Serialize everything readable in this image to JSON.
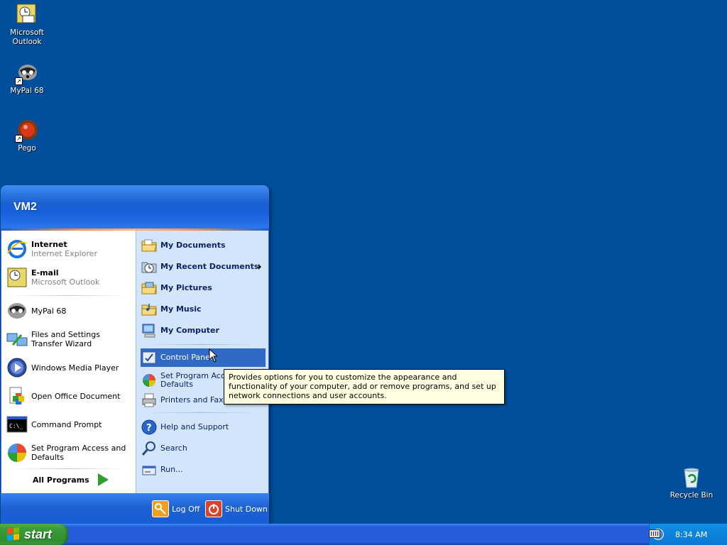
{
  "desktop": {
    "icons": [
      {
        "label": "Microsoft\nOutlook",
        "icon": "outlook-icon"
      },
      {
        "label": "MyPal 68",
        "icon": "mypal-icon"
      },
      {
        "label": "Pego",
        "icon": "pego-icon"
      },
      {
        "label": "Recycle Bin",
        "icon": "recycle-bin-icon"
      }
    ]
  },
  "start_menu": {
    "user": "VM2",
    "pinned": [
      {
        "title": "Internet",
        "subtitle": "Internet Explorer",
        "icon": "internet-explorer-icon"
      },
      {
        "title": "E-mail",
        "subtitle": "Microsoft Outlook",
        "icon": "outlook-icon"
      }
    ],
    "recent": [
      {
        "label": "MyPal 68",
        "icon": "mypal-icon"
      },
      {
        "label": "Files and Settings Transfer Wizard",
        "icon": "transfer-wizard-icon"
      },
      {
        "label": "Windows Media Player",
        "icon": "media-player-icon"
      },
      {
        "label": "Open Office Document",
        "icon": "office-document-icon"
      },
      {
        "label": "Command Prompt",
        "icon": "command-prompt-icon"
      },
      {
        "label": "Set Program Access and Defaults",
        "icon": "program-access-icon"
      }
    ],
    "all_programs": "All Programs",
    "places": [
      {
        "label": "My Documents",
        "icon": "folder-icon"
      },
      {
        "label": "My Recent Documents",
        "icon": "recent-documents-icon"
      },
      {
        "label": "My Pictures",
        "icon": "pictures-folder-icon"
      },
      {
        "label": "My Music",
        "icon": "music-folder-icon"
      },
      {
        "label": "My Computer",
        "icon": "computer-icon"
      }
    ],
    "system": [
      {
        "label": "Control Panel",
        "icon": "control-panel-icon"
      },
      {
        "label": "Set Program Access and Defaults",
        "icon": "program-access-icon"
      },
      {
        "label": "Printers and Faxes",
        "icon": "printer-icon"
      }
    ],
    "help": [
      {
        "label": "Help and Support",
        "icon": "help-icon"
      },
      {
        "label": "Search",
        "icon": "search-icon"
      },
      {
        "label": "Run...",
        "icon": "run-icon"
      }
    ],
    "log_off": "Log Off",
    "shut_down": "Shut Down"
  },
  "tooltip": "Provides options for you to customize the appearance and functionality of your computer, add or remove programs, and set up network connections and user accounts.",
  "taskbar": {
    "start_label": "start",
    "clock": "8:34 AM"
  },
  "colors": {
    "desktop": "#014f9c",
    "highlight": "#316ac5",
    "start_green": "#3c9d3c"
  }
}
